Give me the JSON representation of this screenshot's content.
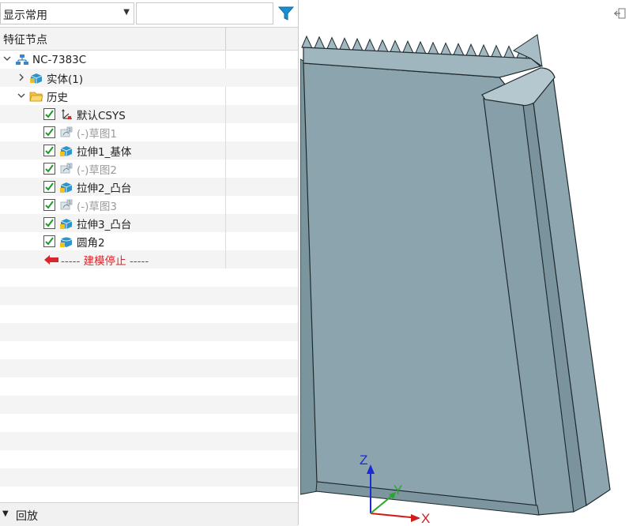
{
  "filter": {
    "display_value": "显示常用",
    "search_value": "",
    "search_placeholder": ""
  },
  "tree_header": {
    "column1": "特征节点"
  },
  "tree": [
    {
      "label": "NC-7383C",
      "icon": "part-icon",
      "state": "normal"
    },
    {
      "label": "实体(1)",
      "icon": "solid-body-icon",
      "state": "normal"
    },
    {
      "label": "历史",
      "icon": "folder-icon",
      "state": "normal"
    },
    {
      "label": "默认CSYS",
      "icon": "csys-icon",
      "state": "checked"
    },
    {
      "label": "(-)草图1",
      "icon": "sketch-icon",
      "state": "checked-dim"
    },
    {
      "label": "拉伸1_基体",
      "icon": "extrude-icon",
      "state": "checked"
    },
    {
      "label": "(-)草图2",
      "icon": "sketch-icon",
      "state": "checked-dim"
    },
    {
      "label": "拉伸2_凸台",
      "icon": "extrude-icon",
      "state": "checked"
    },
    {
      "label": "(-)草图3",
      "icon": "sketch-icon",
      "state": "checked-dim"
    },
    {
      "label": "拉伸3_凸台",
      "icon": "extrude-icon",
      "state": "checked"
    },
    {
      "label": "圆角2",
      "icon": "fillet-icon",
      "state": "checked"
    },
    {
      "label": "----- 建模停止 -----",
      "icon": "stop-arrow-icon",
      "state": "stop"
    }
  ],
  "footer": {
    "label": "回放"
  },
  "axes": {
    "x": "X",
    "y": "Y",
    "z": "Z"
  },
  "colors": {
    "model_fill": "#8aa3ac",
    "model_edge": "#1e2a2e",
    "stop_red": "#d7262b",
    "check_green": "#1c9b2b",
    "filter_blue": "#1a8fd0"
  }
}
